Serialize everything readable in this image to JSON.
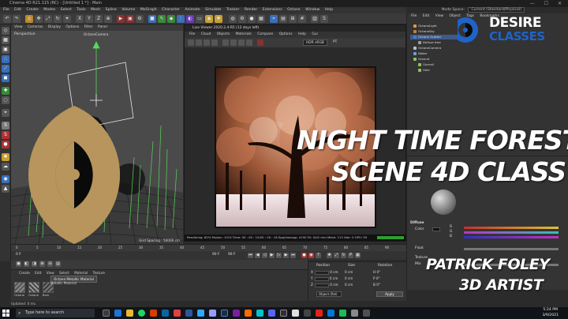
{
  "window": {
    "title": "Cinema 4D R21.115 (RC) - [Untitled 1 *] - Main",
    "controls": "—  ☐  ✕"
  },
  "menubar": [
    "File",
    "Edit",
    "Create",
    "Modes",
    "Select",
    "Tools",
    "Mesh",
    "Spline",
    "Volume",
    "MoGraph",
    "Character",
    "Animate",
    "Simulate",
    "Tracker",
    "Render",
    "Extensions",
    "Octane",
    "Window",
    "Help"
  ],
  "nodespace": {
    "label": "Node Space:",
    "value": "Current (Standard/Physical)",
    "layout_label": "Layout:",
    "layout_value": "Octane_Render (User)"
  },
  "viewport": {
    "menu": [
      "View",
      "Cameras",
      "Display",
      "Options",
      "Filter",
      "Panel"
    ],
    "label": "Perspective",
    "camera": "OctaneCamera",
    "grid_spacing": "Grid Spacing : 50000 cm"
  },
  "liveviewer": {
    "title": "Live Viewer 2020.2.4-R5 (12 days left)",
    "menu": [
      "File",
      "Cloud",
      "Objects",
      "Materials",
      "Compare",
      "Options",
      "Help",
      "Gui"
    ],
    "hdr": "HDR sRGB",
    "pt": "PT",
    "status": "Rendering: 82%   Ms/sec: 1015   Time: 00 : 00 : 15/00 : 00 : 18   Spp/maxspp: 4150   Tri: 0/41 mm   Mesh: 113   Hair: 0   GPU: 59"
  },
  "objmgr": {
    "menu": [
      "File",
      "Edit",
      "View",
      "Object",
      "Tags",
      "Bookmarks"
    ],
    "objects": [
      {
        "name": "OctaneLight",
        "color": "#e0a030"
      },
      {
        "name": "OctaneSky",
        "color": "#c08040"
      },
      {
        "name": "Octane Scatter",
        "color": "#3f7bd8",
        "selected": true
      },
      {
        "name": "Defuse tree",
        "color": "#a0a0a0"
      },
      {
        "name": "OctaneCamera",
        "color": "#c0c0c0"
      },
      {
        "name": "Water",
        "color": "#6fa0d0"
      },
      {
        "name": "Ground",
        "color": "#90c060"
      },
      {
        "name": "Overall",
        "color": "#90c060"
      },
      {
        "name": "Hole",
        "color": "#90c060"
      }
    ]
  },
  "logo": {
    "line1": "DESIRE",
    "line2": "CLASSES"
  },
  "overlay": {
    "line1": "NIGHT TIME FOREST",
    "line2": "SCENE 4D CLASS",
    "author": "PATRICK FOLEY",
    "role": "3D ARTIST"
  },
  "attributes": {
    "section_diffuse": "Diffuse",
    "color_label": "Color",
    "float_label": "Float",
    "texture_label": "Texture",
    "mix_label": "Mix",
    "r": "R",
    "g": "G",
    "b": "B"
  },
  "timeline": {
    "ticks": [
      "0",
      "5",
      "10",
      "15",
      "20",
      "25",
      "30",
      "35",
      "40",
      "45",
      "50",
      "55",
      "60",
      "65",
      "70",
      "75",
      "80",
      "85",
      "90"
    ],
    "start_field": "0 F",
    "end_field": "90 F",
    "end_field2": "90 F"
  },
  "materials": {
    "menu": [
      "Create",
      "Edit",
      "View",
      "Select",
      "Material",
      "Texture"
    ],
    "tooltip": "Octane Metallic Material",
    "tooltip_sub": "Metallic Material",
    "thumb_labels": [
      "Octane",
      "Octane",
      "Bark"
    ]
  },
  "coordinates": {
    "headers": [
      "Position",
      "Size",
      "Rotation"
    ],
    "rows": [
      {
        "axis": "X",
        "pos": "0 cm",
        "size": "0 cm",
        "rot_axis": "H",
        "rot": "0°"
      },
      {
        "axis": "Y",
        "pos": "0 cm",
        "size": "0 cm",
        "rot_axis": "P",
        "rot": "0°"
      },
      {
        "axis": "Z",
        "pos": "0 cm",
        "size": "0 cm",
        "rot_axis": "B",
        "rot": "0°"
      }
    ],
    "mode": "Object (Rel)",
    "apply": "Apply"
  },
  "statusline": "Updated: 0 ms.",
  "taskbar": {
    "search": "Type here to search",
    "time": "5:24 PM",
    "date": "3/9/2021"
  },
  "colors": {
    "accent_gold": "#b7955c",
    "brand_blue": "#1f63c9",
    "selection": "#3f5a8a",
    "render_progress": "#2f9e2f"
  }
}
